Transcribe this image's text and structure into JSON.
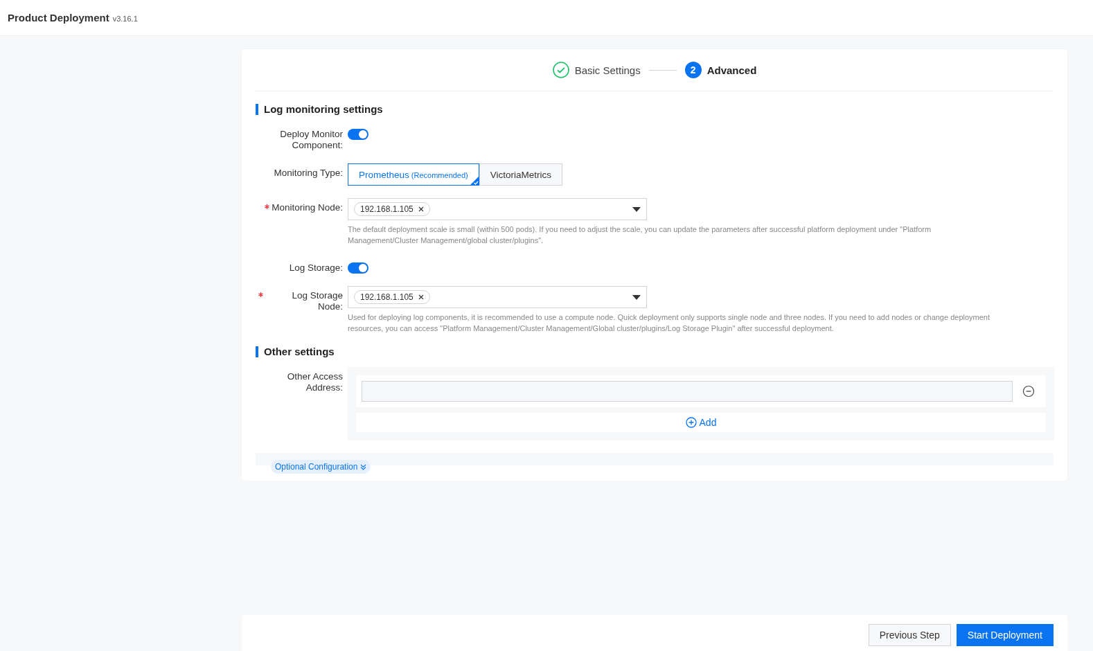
{
  "header": {
    "title": "Product Deployment",
    "version": "v3.16.1"
  },
  "steps": [
    {
      "label": "Basic Settings",
      "done": true,
      "current": false
    },
    {
      "label": "Advanced",
      "done": false,
      "current": true,
      "number": "2"
    }
  ],
  "sections": [
    {
      "title": "Log monitoring settings",
      "fields": [
        {
          "kind": "switch",
          "label": "Deploy Monitor Component:",
          "required": false,
          "on": true
        },
        {
          "kind": "segmented",
          "label": "Monitoring Type:",
          "required": false,
          "options": [
            {
              "label": "Prometheus",
              "note": "(Recommended)",
              "selected": true
            },
            {
              "label": "VictoriaMetrics",
              "selected": false
            }
          ]
        },
        {
          "kind": "select",
          "label": "Monitoring Node:",
          "required": true,
          "tags": [
            "192.168.1.105"
          ],
          "help": "The default deployment scale is small (within 500 pods). If you need to adjust the scale, you can update the parameters after successful platform deployment under \"Platform Management/Cluster Management/global cluster/plugins\"."
        },
        {
          "kind": "switch",
          "label": "Log Storage:",
          "required": false,
          "on": true
        },
        {
          "kind": "select",
          "label": "Log Storage Node:",
          "required": true,
          "tags": [
            "192.168.1.105"
          ],
          "help": "Used for deploying log components, it is recommended to use a compute node. Quick deployment only supports single node and three nodes. If you need to add nodes or change deployment resources, you can access \"Platform Management/Cluster Management/Global cluster/plugins/Log Storage Plugin\" after successful deployment."
        }
      ]
    },
    {
      "title": "Other settings",
      "fields": [
        {
          "kind": "list",
          "label": "Other Access Address:",
          "required": false,
          "entries": [
            {
              "removable": true
            }
          ],
          "add_label": "Add"
        }
      ]
    }
  ],
  "optional": {
    "label": "Optional Configuration",
    "expanded": false
  },
  "footer": {
    "buttons": [
      {
        "label": "Previous Step",
        "kind": "default"
      },
      {
        "label": "Start Deployment",
        "kind": "primary"
      }
    ]
  }
}
